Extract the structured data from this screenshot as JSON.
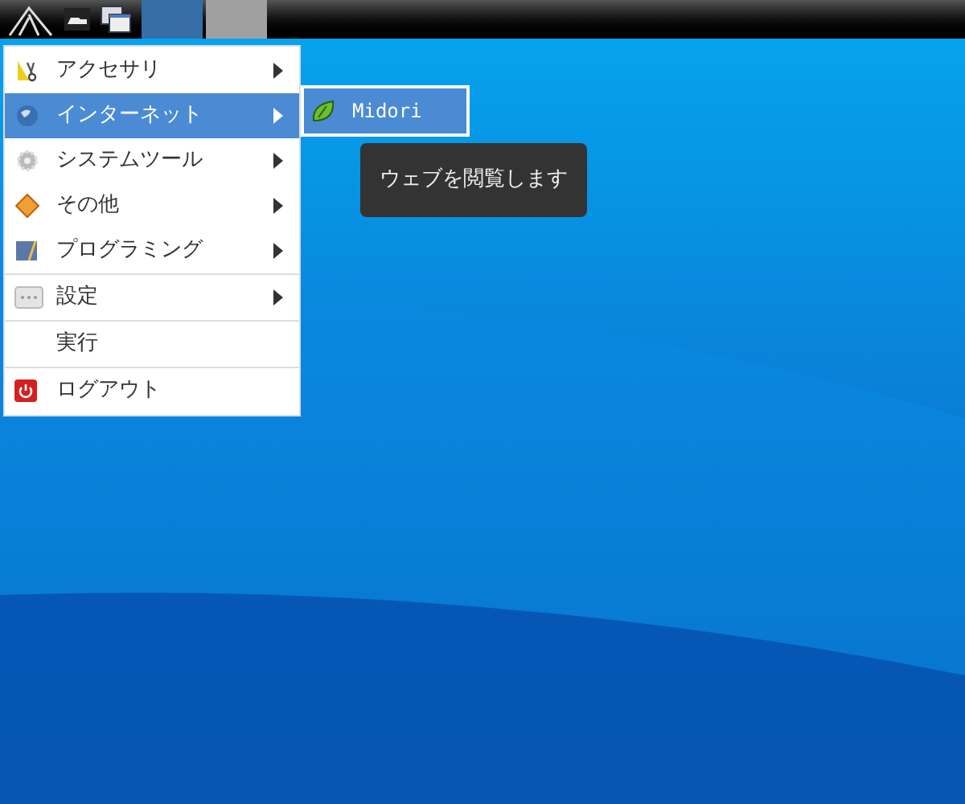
{
  "taskbar": {
    "task_buttons": [
      {
        "selected": true
      },
      {
        "selected": false
      }
    ]
  },
  "menu": {
    "groups": [
      [
        {
          "label": "アクセサリ",
          "submenu": true,
          "selected": false
        },
        {
          "label": "インターネット",
          "submenu": true,
          "selected": true
        },
        {
          "label": "システムツール",
          "submenu": true,
          "selected": false
        },
        {
          "label": "その他",
          "submenu": true,
          "selected": false
        },
        {
          "label": "プログラミング",
          "submenu": true,
          "selected": false
        }
      ],
      [
        {
          "label": "設定",
          "submenu": true,
          "selected": false
        }
      ],
      [
        {
          "label": "実行",
          "submenu": false,
          "selected": false
        }
      ],
      [
        {
          "label": "ログアウト",
          "submenu": false,
          "selected": false
        }
      ]
    ]
  },
  "submenu": {
    "items": [
      {
        "label": "Midori",
        "selected": true
      }
    ]
  },
  "tooltip": {
    "text": "ウェブを閲覧します"
  }
}
